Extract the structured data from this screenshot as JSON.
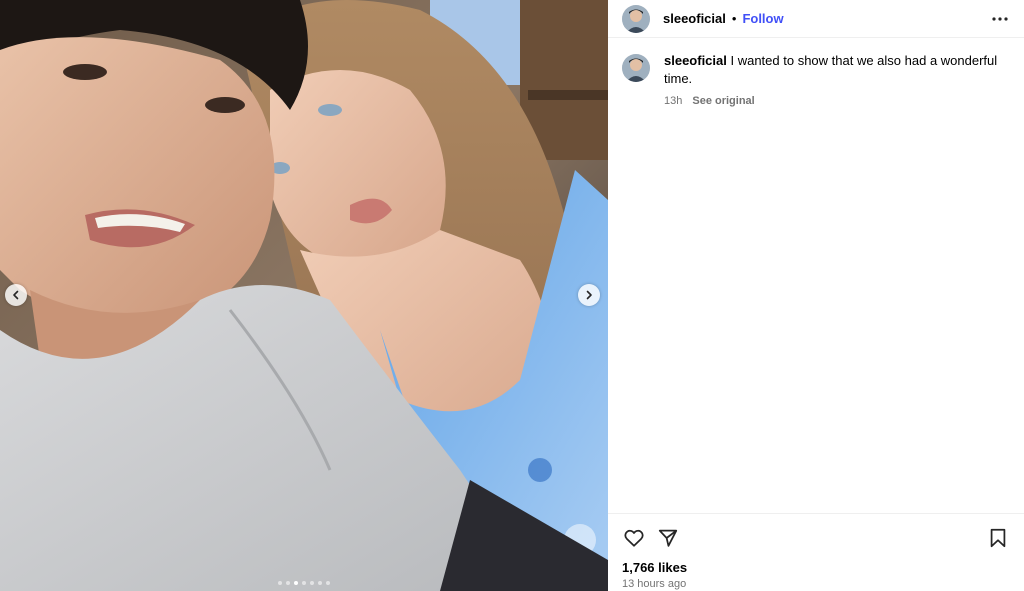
{
  "post": {
    "username": "sleeoficial",
    "separator": "•",
    "follow_label": "Follow",
    "caption_username": "sleeoficial",
    "caption_text": " I wanted to show that we also had a wonderful time.",
    "caption_time": "13h",
    "see_original_label": "See original",
    "likes": "1,766 likes",
    "posted_ago": "13 hours ago"
  },
  "carousel": {
    "slide_count": 7,
    "active_index": 2
  },
  "colors": {
    "follow": "#4150f7",
    "meta_text": "#737373",
    "divider": "#efefef"
  },
  "icons": {
    "more": "more-options-icon",
    "like": "heart-icon",
    "share": "send-icon",
    "save": "bookmark-icon",
    "prev": "chevron-left-icon",
    "next": "chevron-right-icon"
  }
}
